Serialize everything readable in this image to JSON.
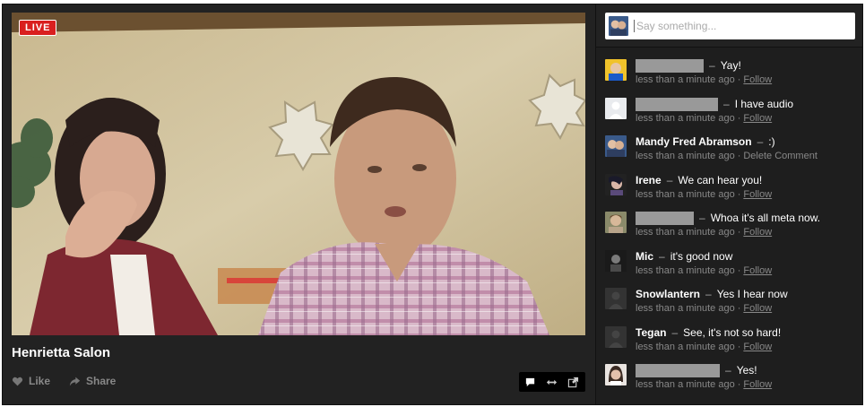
{
  "video": {
    "live_label": "LIVE",
    "title": "Henrietta Salon",
    "like_label": "Like",
    "share_label": "Share"
  },
  "chat": {
    "placeholder": "Say something...",
    "messages": [
      {
        "name": "",
        "text": "Yay!",
        "time": "less than a minute ago",
        "action": "Follow"
      },
      {
        "name": "",
        "text": "I have audio",
        "time": "less than a minute ago",
        "action": "Follow"
      },
      {
        "name": "Mandy Fred Abramson",
        "text": ":)",
        "time": "less than a minute ago",
        "action": "Delete Comment"
      },
      {
        "name": "Irene",
        "text": "We can hear you!",
        "time": "less than a minute ago",
        "action": "Follow"
      },
      {
        "name": "",
        "text": "Whoa it's all meta now.",
        "time": "less than a minute ago",
        "action": "Follow"
      },
      {
        "name": "Mic",
        "text": "it's good now",
        "time": "less than a minute ago",
        "action": "Follow"
      },
      {
        "name": "Snowlantern",
        "text": "Yes I hear now",
        "time": "less than a minute ago",
        "action": "Follow"
      },
      {
        "name": "Tegan",
        "text": "See, it's not so hard!",
        "time": "less than a minute ago",
        "action": "Follow"
      },
      {
        "name": "",
        "text": "Yes!",
        "time": "less than a minute ago",
        "action": "Follow"
      }
    ]
  },
  "colors": {
    "live": "#d91f1f",
    "panel": "#222222",
    "chat_bg": "#1e1e1e"
  }
}
